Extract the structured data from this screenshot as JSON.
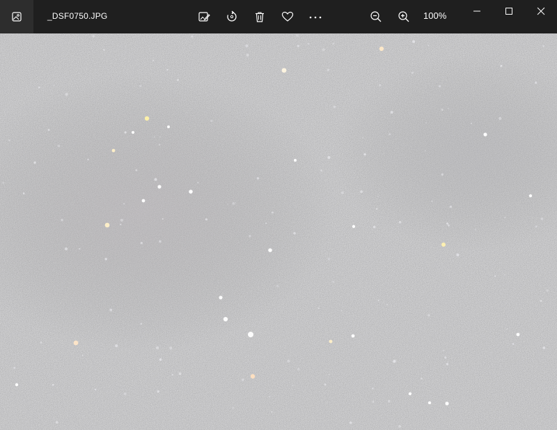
{
  "window": {
    "title": "_DSF0750.JPG",
    "zoom_label": "100%"
  },
  "toolbar": {
    "icons": [
      "app-photo-icon",
      "edit-image-icon",
      "rotate-icon",
      "delete-icon",
      "favorite-heart-icon",
      "more-options-icon",
      "zoom-out-icon",
      "zoom-in-icon"
    ]
  },
  "window_controls": [
    "minimize-icon",
    "maximize-icon",
    "close-icon"
  ],
  "colors": {
    "titlebar": "#1f1f1f",
    "app_button": "#2d2d2d",
    "photo_base": "#8e8e8e"
  }
}
